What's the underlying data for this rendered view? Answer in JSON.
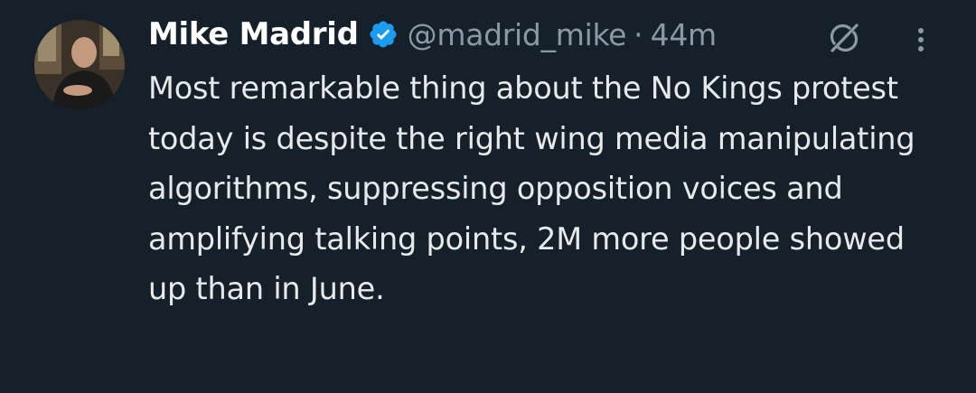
{
  "tweet": {
    "author_name": "Mike Madrid",
    "handle": "@madrid_mike",
    "separator": "·",
    "time": "44m",
    "text": "Most remarkable thing about the No Kings protest today is despite the right wing media manipulating algorithms, suppressing opposition voices and amplifying talking points, 2M more people showed up than in June."
  },
  "icons": {
    "verified": "verified-badge-icon",
    "grok": "grok-icon",
    "more": "more-options-icon"
  },
  "colors": {
    "background": "#15202b",
    "name": "#ffffff",
    "secondary": "#8b98a5",
    "body_text": "#e7e9ea",
    "verified": "#1d9bf0"
  }
}
